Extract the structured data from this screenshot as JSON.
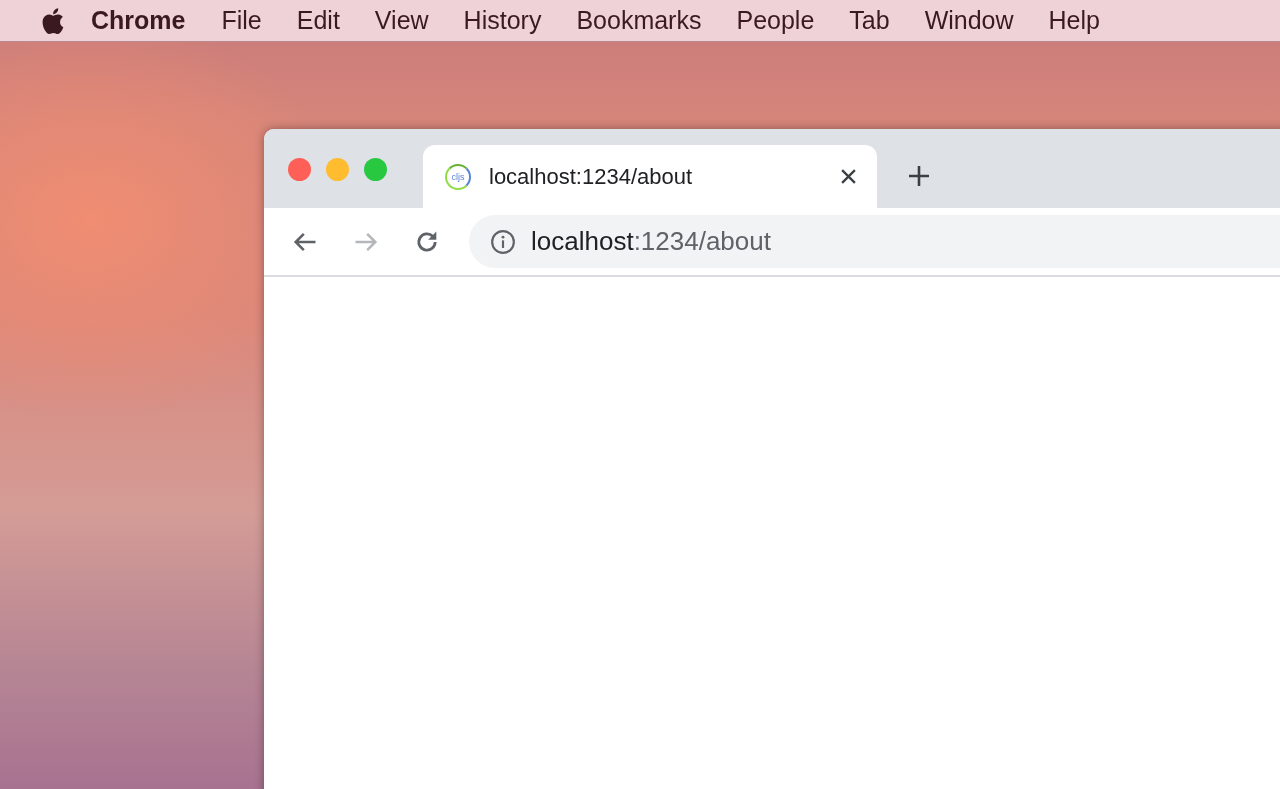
{
  "menu_bar": {
    "app_name": "Chrome",
    "items": [
      "File",
      "Edit",
      "View",
      "History",
      "Bookmarks",
      "People",
      "Tab",
      "Window",
      "Help"
    ]
  },
  "browser": {
    "tabs": [
      {
        "favicon_text": "cljs",
        "title": "localhost:1234/about",
        "selected": true
      }
    ],
    "nav_buttons": [
      {
        "kind": "back",
        "disabled": false
      },
      {
        "kind": "forward",
        "disabled": true
      },
      {
        "kind": "reload",
        "disabled": false
      }
    ],
    "address": {
      "host": "localhost",
      "path": ":1234/about"
    }
  }
}
